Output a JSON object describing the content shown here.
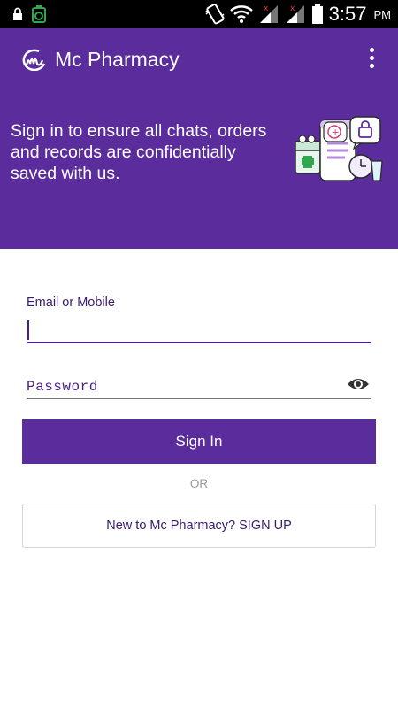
{
  "status_bar": {
    "time": "3:57",
    "ampm": "PM",
    "icons": [
      "lock-icon",
      "battery-saver-icon",
      "vibrate-icon",
      "wifi-icon",
      "signal-icon",
      "signal-icon",
      "battery-icon"
    ]
  },
  "app_bar": {
    "title": "Mc Pharmacy",
    "logo_icon": "mc-logo-icon",
    "menu_icon": "more-vert-icon"
  },
  "hero": {
    "text": "Sign in to ensure all chats, orders and records are confidentially saved with us.",
    "illustration": "secure-pharmacy-illustration"
  },
  "form": {
    "email_label": "Email or Mobile",
    "email_value": "",
    "password_placeholder": "Password",
    "password_value": "",
    "password_toggle_icon": "eye-icon",
    "signin_label": "Sign In",
    "or_text": "OR",
    "signup_label": "New to Mc Pharmacy? SIGN UP"
  },
  "colors": {
    "primary": "#5b2c9b",
    "text_purple": "#3a1a6e",
    "status_bar": "#000000",
    "divider_gray": "#9a9a9a"
  }
}
